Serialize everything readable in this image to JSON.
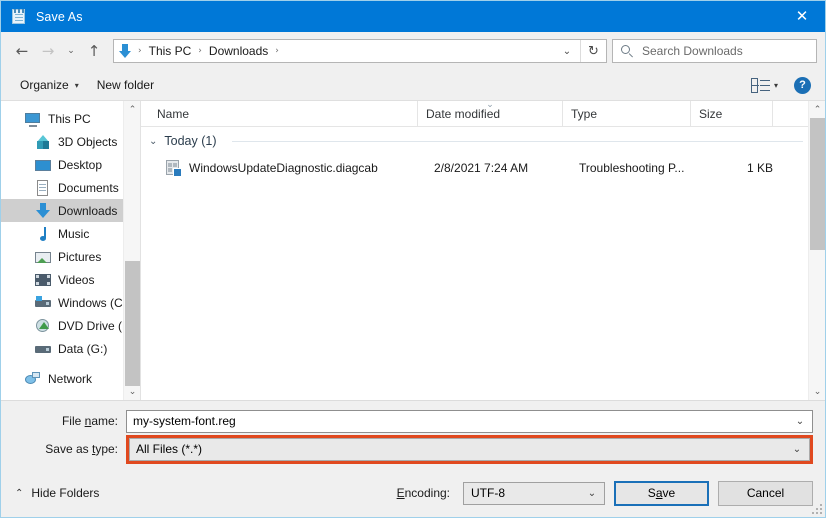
{
  "window": {
    "title": "Save As",
    "app_icon": "notepad-icon",
    "close_label": "✕",
    "titlebar_color": "#0078d7"
  },
  "nav": {
    "back_label": "←",
    "forward_label": "→",
    "recent_label": "⌄",
    "up_label": "↑",
    "breadcrumbs": [
      {
        "label": "This PC"
      },
      {
        "label": "Downloads"
      }
    ],
    "separator": "›",
    "dropdown_label": "⌄",
    "refresh_label": "↻"
  },
  "search": {
    "placeholder": "Search Downloads",
    "icon": "search-icon"
  },
  "toolbar": {
    "organize_label": "Organize",
    "organize_caret": "▾",
    "new_folder_label": "New folder",
    "view_caret": "▾",
    "help_label": "?"
  },
  "sidebar": {
    "items": [
      {
        "label": "This PC",
        "icon": "computer-icon",
        "indent": false,
        "selected": false,
        "spaced": false
      },
      {
        "label": "3D Objects",
        "icon": "3d-objects-icon",
        "indent": true,
        "selected": false,
        "spaced": false
      },
      {
        "label": "Desktop",
        "icon": "desktop-icon",
        "indent": true,
        "selected": false,
        "spaced": false
      },
      {
        "label": "Documents",
        "icon": "documents-icon",
        "indent": true,
        "selected": false,
        "spaced": false
      },
      {
        "label": "Downloads",
        "icon": "downloads-icon",
        "indent": true,
        "selected": true,
        "spaced": false
      },
      {
        "label": "Music",
        "icon": "music-icon",
        "indent": true,
        "selected": false,
        "spaced": false
      },
      {
        "label": "Pictures",
        "icon": "pictures-icon",
        "indent": true,
        "selected": false,
        "spaced": false
      },
      {
        "label": "Videos",
        "icon": "videos-icon",
        "indent": true,
        "selected": false,
        "spaced": false
      },
      {
        "label": "Windows (C:)",
        "icon": "drive-icon",
        "indent": true,
        "selected": false,
        "spaced": false
      },
      {
        "label": "DVD Drive (D:) C",
        "icon": "dvd-drive-icon",
        "indent": true,
        "selected": false,
        "spaced": false
      },
      {
        "label": "Data (G:)",
        "icon": "drive-icon",
        "indent": true,
        "selected": false,
        "spaced": false
      },
      {
        "label": "Network",
        "icon": "network-icon",
        "indent": false,
        "selected": false,
        "spaced": true
      }
    ]
  },
  "filelist": {
    "columns": [
      {
        "label": "Name",
        "sorted": false
      },
      {
        "label": "Date modified",
        "sorted": true
      },
      {
        "label": "Type",
        "sorted": false
      },
      {
        "label": "Size",
        "sorted": false
      }
    ],
    "sort_indicator": "⌄",
    "group": {
      "chevron": "⌄",
      "label": "Today (1)"
    },
    "rows": [
      {
        "name": "WindowsUpdateDiagnostic.diagcab",
        "date_modified": "2/8/2021 7:24 AM",
        "type": "Troubleshooting P...",
        "size": "1 KB",
        "icon": "diagcab-file-icon"
      }
    ]
  },
  "form": {
    "file_name_label_pre": "File ",
    "file_name_label_key": "n",
    "file_name_label_post": "ame:",
    "file_name_value": "my-system-font.reg",
    "save_as_type_label_pre": "Save as ",
    "save_as_type_label_key": "t",
    "save_as_type_label_post": "ype:",
    "save_as_type_value": "All Files  (*.*)",
    "dropdown_arrow": "⌄",
    "highlight_color": "#e0491f"
  },
  "footer": {
    "hide_folders_chevron": "⌃",
    "hide_folders_label": "Hide Folders",
    "encoding_label_pre": "E",
    "encoding_label_post": "ncoding:",
    "encoding_value": "UTF-8",
    "encoding_arrow": "⌄",
    "save_label_pre": "S",
    "save_label_key": "a",
    "save_label_post": "ve",
    "cancel_label": "Cancel"
  }
}
